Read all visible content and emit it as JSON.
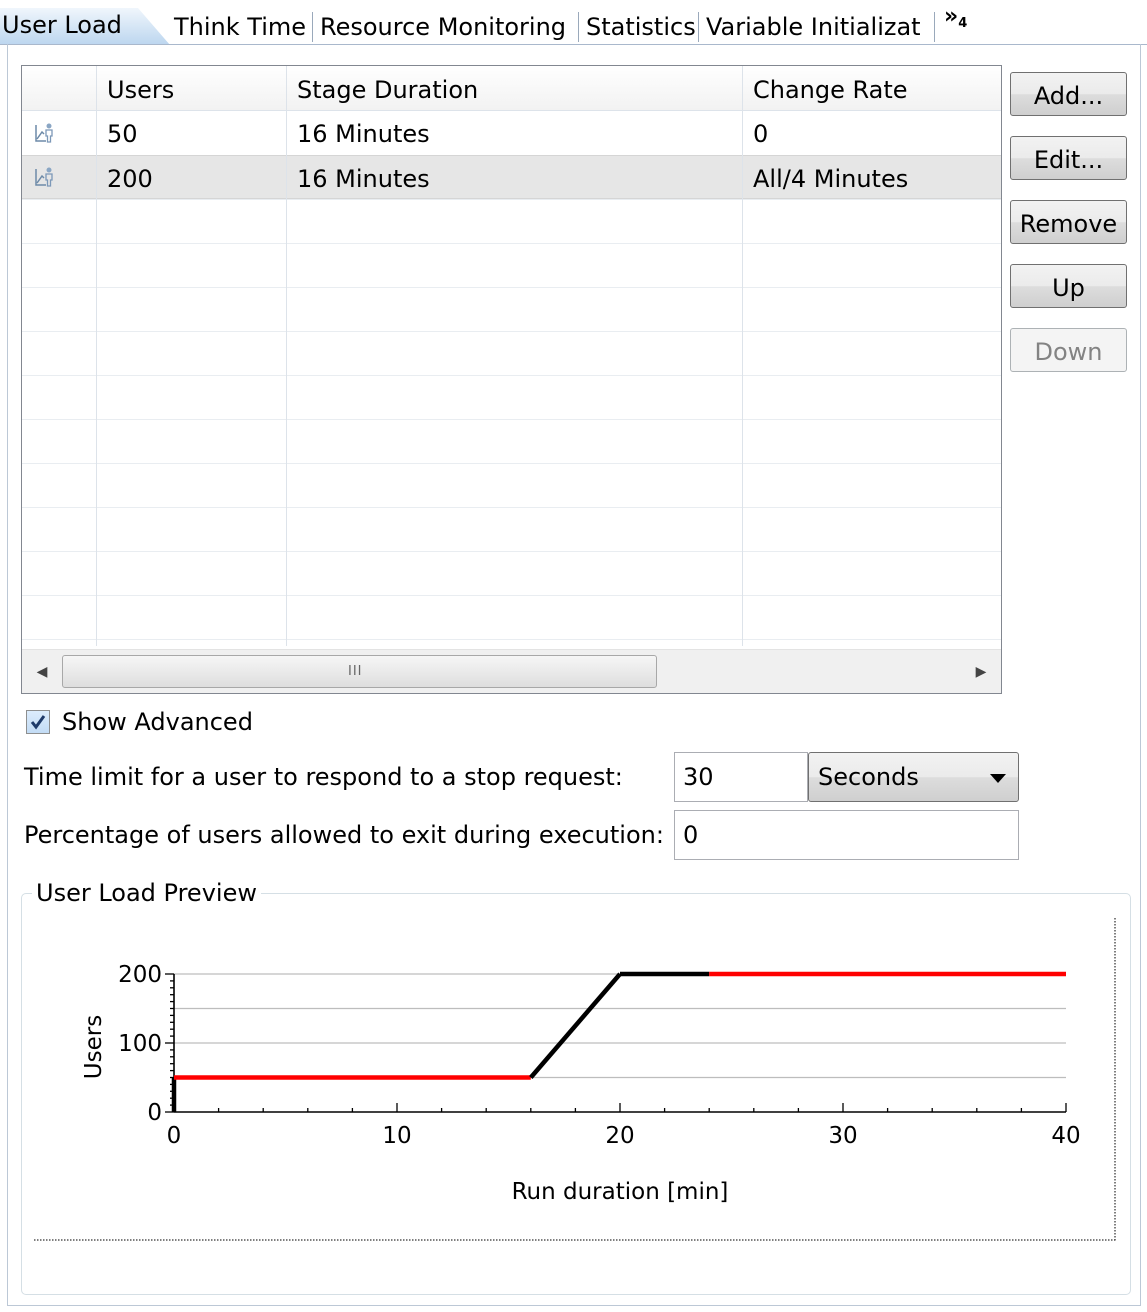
{
  "tabs": [
    {
      "label": "User Load",
      "active": true
    },
    {
      "label": "Think Time"
    },
    {
      "label": "Resource Monitoring"
    },
    {
      "label": "Statistics"
    },
    {
      "label": "Variable Initializat"
    }
  ],
  "tab_overflow": {
    "glyph": "»",
    "count": "4"
  },
  "table": {
    "columns": [
      "",
      "Users",
      "Stage Duration",
      "Change Rate"
    ],
    "rows": [
      {
        "icon": "ramp-user-icon",
        "users": "50",
        "stage_duration": "16 Minutes",
        "change_rate": "0",
        "selected": false
      },
      {
        "icon": "ramp-user-icon",
        "users": "200",
        "stage_duration": "16 Minutes",
        "change_rate": "All/4 Minutes",
        "selected": true
      }
    ],
    "scrollbar_grip": "III"
  },
  "buttons": {
    "add": "Add...",
    "edit": "Edit...",
    "remove": "Remove",
    "up": "Up",
    "down": "Down"
  },
  "show_advanced": {
    "label": "Show Advanced",
    "checked": true
  },
  "stop_time": {
    "label": "Time limit for a user to respond to a stop request:",
    "value": "30",
    "unit": "Seconds"
  },
  "exit_percentage": {
    "label": "Percentage of users allowed to exit during execution:",
    "value": "0"
  },
  "preview": {
    "title": "User Load Preview"
  },
  "chart_data": {
    "type": "line",
    "title": "",
    "xlabel": "Run duration [min]",
    "ylabel": "Users",
    "xlim": [
      0,
      40
    ],
    "ylim": [
      0,
      200
    ],
    "xticks": [
      0,
      10,
      20,
      30,
      40
    ],
    "yticks": [
      0,
      100,
      200
    ],
    "grid": "horizontal",
    "segments": [
      {
        "x": [
          0,
          0
        ],
        "y": [
          0,
          50
        ],
        "color": "#000000"
      },
      {
        "x": [
          0,
          16
        ],
        "y": [
          50,
          50
        ],
        "color": "#ff0000"
      },
      {
        "x": [
          16,
          20
        ],
        "y": [
          50,
          200
        ],
        "color": "#000000"
      },
      {
        "x": [
          20,
          24
        ],
        "y": [
          200,
          200
        ],
        "color": "#000000"
      },
      {
        "x": [
          24,
          40
        ],
        "y": [
          200,
          200
        ],
        "color": "#ff0000"
      }
    ]
  }
}
